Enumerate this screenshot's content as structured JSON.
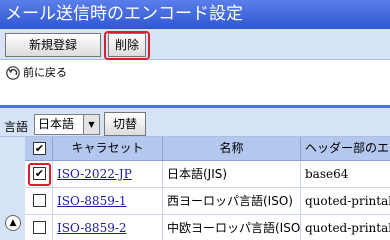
{
  "title": "メール送信時のエンコード設定",
  "toolbar": {
    "new_label": "新規登録",
    "delete_label": "削除"
  },
  "back": {
    "label": "前に戻る",
    "icon": "back-arrow-icon"
  },
  "language": {
    "label": "言語",
    "selected": "日本語",
    "switch_label": "切替"
  },
  "table": {
    "columns": [
      "キャラセット",
      "名称",
      "ヘッダー部のエンコ"
    ],
    "select_all_checked": true,
    "rows": [
      {
        "checked": true,
        "charset": "ISO-2022-JP",
        "name": "日本語(JIS)",
        "encoding": "base64"
      },
      {
        "checked": false,
        "charset": "ISO-8859-1",
        "name": "西ヨーロッパ言語(ISO)",
        "encoding": "quoted-printable"
      },
      {
        "checked": false,
        "charset": "ISO-8859-2",
        "name": "中欧ヨーロッパ言語(ISO)",
        "encoding": "quoted-printable"
      }
    ]
  },
  "colors": {
    "title_bar": "#3b63dc",
    "highlight": "#d8202a",
    "header_row": "#b4c7ec",
    "panel": "#d6e3f7"
  }
}
